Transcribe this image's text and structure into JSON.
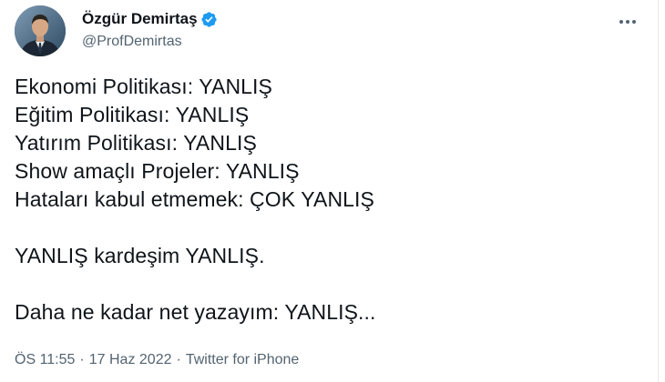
{
  "author": {
    "name": "Özgür Demirtaş",
    "handle": "@ProfDemirtas",
    "verified": true
  },
  "tweet": {
    "lines": [
      "Ekonomi Politikası: YANLIŞ",
      "Eğitim Politikası: YANLIŞ",
      "Yatırım Politikası: YANLIŞ",
      "Show amaçlı Projeler: YANLIŞ",
      "Hataları kabul etmemek: ÇOK YANLIŞ",
      "YANLIŞ kardeşim YANLIŞ.",
      "Daha ne kadar net yazayım: YANLIŞ..."
    ]
  },
  "meta": {
    "time": "ÖS 11:55",
    "separator": "·",
    "date": "17 Haz 2022",
    "source": "Twitter for iPhone"
  },
  "icons": {
    "verified": "verified-badge-icon",
    "more": "more-horizontal-icon"
  },
  "colors": {
    "verified_blue": "#1d9bf0",
    "secondary_text": "#536471",
    "primary_text": "#0f1419"
  }
}
